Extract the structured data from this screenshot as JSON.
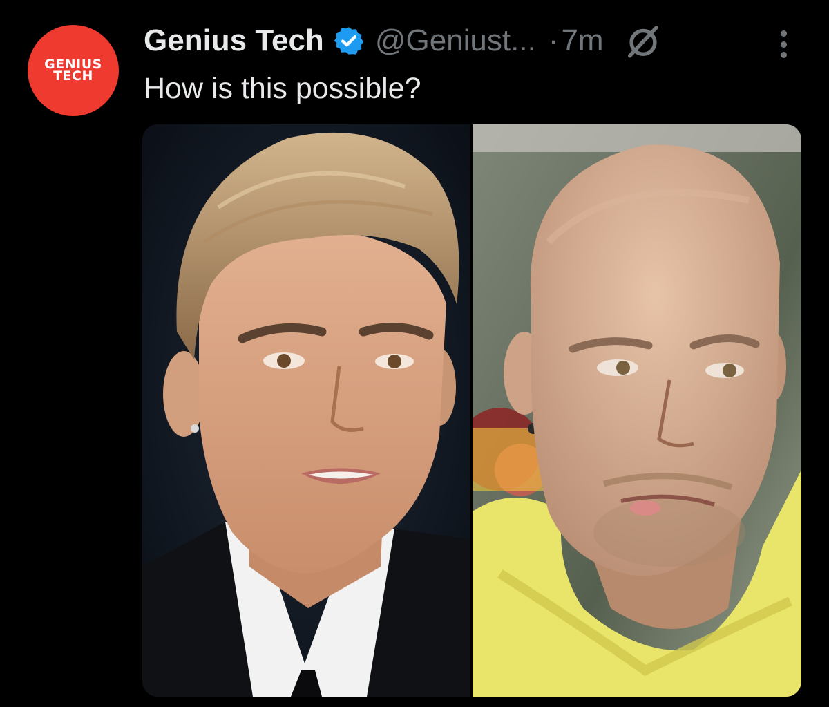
{
  "colors": {
    "background": "#000000",
    "avatar_bg": "#ef3b2f",
    "verified_blue": "#1d9bf0",
    "muted": "#71767b",
    "text": "#e7e9ea"
  },
  "avatar": {
    "line1": "GENIUS",
    "line2": "TECH"
  },
  "header": {
    "name": "Genius Tech",
    "verified_icon": "verified-badge-icon",
    "handle": "@Geniust...",
    "separator": "·",
    "time": "7m",
    "grok_icon": "grok-icon",
    "more_icon": "more-options-icon"
  },
  "post": {
    "text": "How is this possible?",
    "media": [
      {
        "description_icon": "photo-left"
      },
      {
        "description_icon": "photo-right"
      }
    ]
  }
}
